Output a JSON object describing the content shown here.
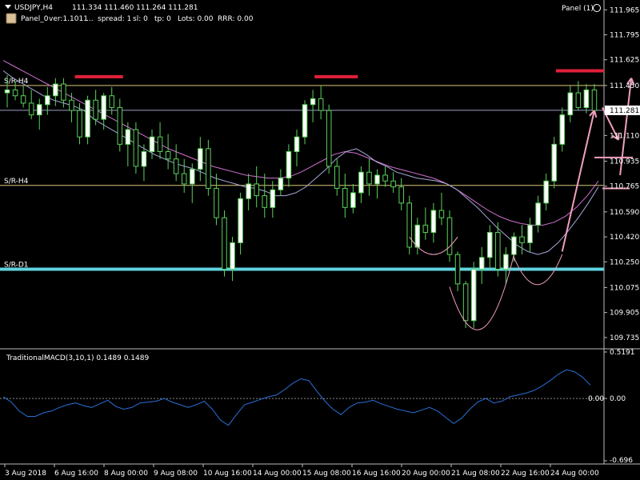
{
  "chart_data": {
    "type": "candlestick",
    "symbol_label": "USDJPY,H4",
    "ohlc_header": "111.334 111.460 111.264 111.281",
    "panel_info": {
      "name": "Panel_0",
      "version": "ver:1.1011",
      "ellipsis": "...",
      "spread": "spread: 1",
      "sl": "sl: 0",
      "tp": "tp: 0",
      "lots": "Lots: 0.00",
      "rrr": "RRR: 0.00"
    },
    "panel_badge": "Panel (1)",
    "price_axis": {
      "range": [
        109.68,
        112.01
      ],
      "ticks": [
        "111.965",
        "111.795",
        "111.625",
        "111.450",
        "111.281",
        "111.110",
        "110.935",
        "110.765",
        "110.590",
        "110.420",
        "110.250",
        "110.075",
        "109.905",
        "109.735"
      ],
      "current_price": "111.281"
    },
    "time_axis": {
      "labels": [
        "3 Aug 2018",
        "6 Aug 16:00",
        "8 Aug 00:00",
        "9 Aug 08:00",
        "10 Aug 16:00",
        "14 Aug 00:00",
        "15 Aug 08:00",
        "16 Aug 16:00",
        "20 Aug 00:00",
        "21 Aug 08:00",
        "22 Aug 16:00",
        "24 Aug 00:00"
      ]
    },
    "levels": [
      {
        "label": "S/R-H4",
        "price": 111.45,
        "color": "#d9c77a"
      },
      {
        "label": "S/R-H4",
        "price": 110.77,
        "color": "#d9c77a"
      },
      {
        "label": "S/R-D1",
        "price": 110.2,
        "color": "#5fd3e0"
      }
    ],
    "current_price_line": 111.281,
    "candles": [
      [
        111.4,
        111.52,
        111.3,
        111.42
      ],
      [
        111.42,
        111.48,
        111.35,
        111.38
      ],
      [
        111.38,
        111.45,
        111.3,
        111.33
      ],
      [
        111.33,
        111.42,
        111.22,
        111.25
      ],
      [
        111.25,
        111.36,
        111.15,
        111.32
      ],
      [
        111.32,
        111.44,
        111.25,
        111.38
      ],
      [
        111.38,
        111.5,
        111.31,
        111.46
      ],
      [
        111.46,
        111.5,
        111.3,
        111.35
      ],
      [
        111.35,
        111.4,
        111.2,
        111.28
      ],
      [
        111.28,
        111.33,
        111.05,
        111.1
      ],
      [
        111.1,
        111.38,
        111.05,
        111.35
      ],
      [
        111.35,
        111.42,
        111.18,
        111.22
      ],
      [
        111.22,
        111.4,
        111.15,
        111.38
      ],
      [
        111.38,
        111.44,
        111.25,
        111.3
      ],
      [
        111.3,
        111.36,
        111.0,
        111.05
      ],
      [
        111.05,
        111.2,
        110.9,
        111.15
      ],
      [
        111.15,
        111.2,
        110.85,
        110.9
      ],
      [
        110.9,
        111.05,
        110.8,
        111.0
      ],
      [
        111.0,
        111.15,
        110.95,
        111.1
      ],
      [
        111.1,
        111.2,
        110.95,
        111.0
      ],
      [
        111.0,
        111.12,
        110.88,
        110.95
      ],
      [
        110.95,
        111.05,
        110.8,
        110.85
      ],
      [
        110.85,
        110.95,
        110.72,
        110.78
      ],
      [
        110.78,
        110.92,
        110.65,
        110.88
      ],
      [
        110.88,
        111.1,
        110.8,
        111.02
      ],
      [
        111.02,
        111.08,
        110.7,
        110.75
      ],
      [
        110.75,
        110.85,
        110.5,
        110.55
      ],
      [
        110.55,
        110.6,
        110.15,
        110.2
      ],
      [
        110.2,
        110.42,
        110.12,
        110.38
      ],
      [
        110.38,
        110.72,
        110.3,
        110.68
      ],
      [
        110.68,
        110.85,
        110.6,
        110.78
      ],
      [
        110.78,
        110.9,
        110.62,
        110.7
      ],
      [
        110.7,
        110.85,
        110.55,
        110.62
      ],
      [
        110.62,
        110.8,
        110.55,
        110.74
      ],
      [
        110.74,
        110.88,
        110.7,
        110.82
      ],
      [
        110.82,
        111.05,
        110.76,
        111.0
      ],
      [
        111.0,
        111.15,
        110.9,
        111.1
      ],
      [
        111.1,
        111.35,
        111.05,
        111.32
      ],
      [
        111.32,
        111.42,
        111.2,
        111.36
      ],
      [
        111.36,
        111.45,
        111.22,
        111.28
      ],
      [
        111.28,
        111.32,
        110.85,
        110.9
      ],
      [
        110.9,
        110.95,
        110.7,
        110.75
      ],
      [
        110.75,
        110.85,
        110.55,
        110.62
      ],
      [
        110.62,
        110.78,
        110.58,
        110.72
      ],
      [
        110.72,
        110.9,
        110.65,
        110.86
      ],
      [
        110.86,
        110.95,
        110.7,
        110.78
      ],
      [
        110.78,
        110.88,
        110.68,
        110.84
      ],
      [
        110.84,
        110.9,
        110.76,
        110.8
      ],
      [
        110.8,
        110.86,
        110.72,
        110.76
      ],
      [
        110.76,
        110.82,
        110.6,
        110.65
      ],
      [
        110.65,
        110.7,
        110.3,
        110.35
      ],
      [
        110.35,
        110.55,
        110.3,
        110.5
      ],
      [
        110.5,
        110.62,
        110.4,
        110.45
      ],
      [
        110.45,
        110.65,
        110.38,
        110.6
      ],
      [
        110.6,
        110.72,
        110.5,
        110.55
      ],
      [
        110.55,
        110.6,
        110.25,
        110.3
      ],
      [
        110.3,
        110.32,
        110.05,
        110.1
      ],
      [
        110.1,
        110.12,
        109.8,
        109.85
      ],
      [
        109.85,
        110.25,
        109.8,
        110.2
      ],
      [
        110.2,
        110.35,
        110.1,
        110.28
      ],
      [
        110.28,
        110.5,
        110.2,
        110.45
      ],
      [
        110.45,
        110.52,
        110.15,
        110.2
      ],
      [
        110.2,
        110.35,
        110.1,
        110.3
      ],
      [
        110.3,
        110.45,
        110.25,
        110.42
      ],
      [
        110.42,
        110.5,
        110.3,
        110.38
      ],
      [
        110.38,
        110.55,
        110.32,
        110.5
      ],
      [
        110.5,
        110.7,
        110.45,
        110.65
      ],
      [
        110.65,
        110.85,
        110.6,
        110.8
      ],
      [
        110.8,
        111.1,
        110.75,
        111.05
      ],
      [
        111.05,
        111.3,
        111.0,
        111.25
      ],
      [
        111.25,
        111.45,
        111.2,
        111.4
      ],
      [
        111.4,
        111.48,
        111.28,
        111.3
      ],
      [
        111.3,
        111.46,
        111.26,
        111.42
      ],
      [
        111.42,
        111.46,
        111.26,
        111.28
      ]
    ],
    "ma_fast": [
      111.55,
      111.5,
      111.46,
      111.42,
      111.38,
      111.35,
      111.33,
      111.31,
      111.28,
      111.22,
      111.18,
      111.14,
      111.1,
      111.06,
      111.02,
      110.98,
      110.95,
      110.92,
      110.9,
      110.88,
      110.85,
      110.82,
      110.8,
      110.78,
      110.76,
      110.75,
      110.73,
      110.7,
      110.7,
      110.72,
      110.76,
      110.82,
      110.88,
      110.95,
      111.0,
      111.02,
      110.98,
      110.93,
      110.9,
      110.86,
      110.84,
      110.82,
      110.81,
      110.8,
      110.78,
      110.74,
      110.68,
      110.62,
      110.55,
      110.48,
      110.42,
      110.36,
      110.32,
      110.3,
      110.32,
      110.38,
      110.46,
      110.55,
      110.65,
      110.76
    ],
    "ma_slow": [
      111.62,
      111.58,
      111.54,
      111.5,
      111.46,
      111.42,
      111.38,
      111.34,
      111.3,
      111.26,
      111.22,
      111.18,
      111.14,
      111.1,
      111.06,
      111.02,
      110.99,
      110.96,
      110.93,
      110.9,
      110.88,
      110.86,
      110.84,
      110.83,
      110.82,
      110.82,
      110.83,
      110.86,
      110.9,
      110.94,
      110.98,
      111.0,
      110.99,
      110.96,
      110.93,
      110.9,
      110.88,
      110.86,
      110.84,
      110.82,
      110.79,
      110.75,
      110.7,
      110.65,
      110.6,
      110.56,
      110.53,
      110.51,
      110.5,
      110.5,
      110.52,
      110.56,
      110.62,
      110.7,
      110.8
    ],
    "macd": {
      "label": "TraditionalMACD(3,10,1) 0.1489 0.1489",
      "range": [
        -0.696,
        0.5191
      ],
      "ticks": [
        "0.5191",
        "0.00",
        "-0.696"
      ],
      "zero_label": "0.00",
      "values": [
        0.02,
        -0.04,
        -0.14,
        -0.2,
        -0.2,
        -0.16,
        -0.14,
        -0.1,
        -0.07,
        -0.05,
        -0.08,
        -0.1,
        -0.06,
        -0.02,
        -0.09,
        -0.12,
        -0.1,
        -0.05,
        -0.04,
        -0.03,
        0.0,
        -0.04,
        -0.07,
        -0.1,
        -0.07,
        -0.03,
        -0.12,
        -0.24,
        -0.3,
        -0.18,
        -0.07,
        -0.04,
        -0.01,
        0.02,
        0.04,
        0.1,
        0.17,
        0.22,
        0.2,
        0.08,
        -0.03,
        -0.12,
        -0.18,
        -0.1,
        -0.05,
        -0.04,
        -0.02,
        -0.06,
        -0.09,
        -0.12,
        -0.14,
        -0.16,
        -0.13,
        -0.1,
        -0.14,
        -0.21,
        -0.28,
        -0.22,
        -0.12,
        -0.04,
        0.0,
        -0.05,
        -0.03,
        0.02,
        0.04,
        0.06,
        0.09,
        0.14,
        0.2,
        0.27,
        0.32,
        0.3,
        0.24,
        0.15
      ]
    }
  },
  "colors": {
    "background": "#000000",
    "bull": "#ffffff",
    "bear": "#000000",
    "wick": "#5ad25a",
    "ma_fast": "#a8a8d8",
    "ma_slow": "#d070d0",
    "macd_line": "#2a6fd6",
    "annotation_red": "#e0203a",
    "annotation_pink": "#f0a0c0"
  }
}
